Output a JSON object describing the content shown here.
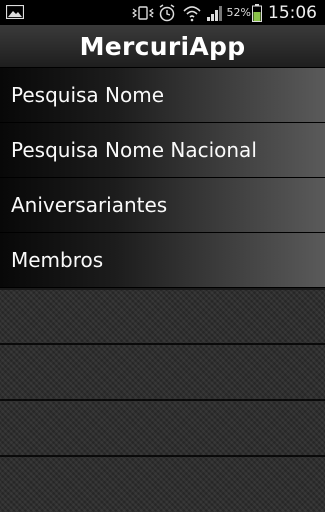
{
  "status_bar": {
    "battery_level": "52%",
    "time": "15:06",
    "icons": [
      "gallery-icon",
      "vibrate-icon",
      "alarm-icon",
      "wifi-icon",
      "signal-icon",
      "battery-icon"
    ]
  },
  "app": {
    "title": "MercuriApp"
  },
  "menu": {
    "items": [
      {
        "label": "Pesquisa Nome"
      },
      {
        "label": "Pesquisa Nome Nacional"
      },
      {
        "label": "Aniversariantes"
      },
      {
        "label": "Membros"
      }
    ]
  },
  "colors": {
    "battery_fill": "#8bc34a",
    "background": "#1a1a1a",
    "text": "#ffffff"
  }
}
